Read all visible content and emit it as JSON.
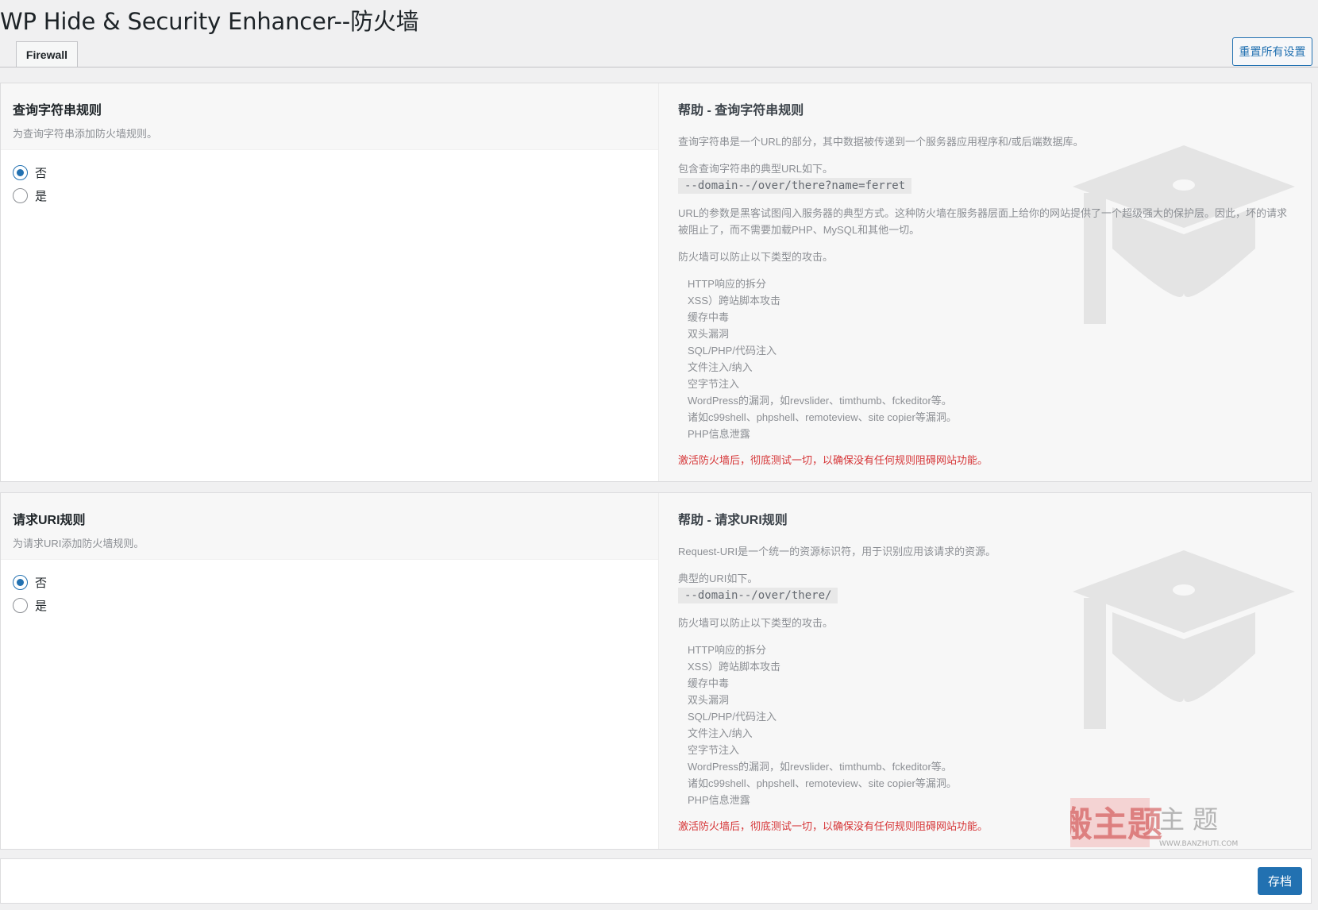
{
  "page": {
    "title": "WP Hide & Security Enhancer--防火墙"
  },
  "tabs": [
    {
      "label": "Firewall",
      "active": true
    }
  ],
  "header": {
    "reset_label": "重置所有设置"
  },
  "sections": [
    {
      "title": "查询字符串规则",
      "description": "为查询字符串添加防火墙规则。",
      "options": [
        {
          "label": "否",
          "checked": true
        },
        {
          "label": "是",
          "checked": false
        }
      ],
      "help": {
        "title": "帮助 - 查询字符串规则",
        "intro": "查询字符串是一个URL的部分，其中数据被传递到一个服务器应用程序和/或后端数据库。",
        "example_label": "包含查询字符串的典型URL如下。",
        "example_code": "--domain--/over/there?name=ferret",
        "extra": "URL的参数是黑客试图闯入服务器的典型方式。这种防火墙在服务器层面上给你的网站提供了一个超级强大的保护层。因此，坏的请求被阻止了，而不需要加载PHP、MySQL和其他一切。",
        "list_intro": "防火墙可以防止以下类型的攻击。",
        "attacks": [
          "HTTP响应的拆分",
          "XSS）跨站脚本攻击",
          "缓存中毒",
          "双头漏洞",
          "SQL/PHP/代码注入",
          "文件注入/纳入",
          "空字节注入",
          "WordPress的漏洞，如revslider、timthumb、fckeditor等。",
          "诸如c99shell、phpshell、remoteview、site copier等漏洞。",
          "PHP信息泄露"
        ],
        "warning": "激活防火墙后，彻底测试一切，以确保没有任何规则阻碍网站功能。"
      }
    },
    {
      "title": "请求URI规则",
      "description": "为请求URI添加防火墙规则。",
      "options": [
        {
          "label": "否",
          "checked": true
        },
        {
          "label": "是",
          "checked": false
        }
      ],
      "help": {
        "title": "帮助 - 请求URI规则",
        "intro": "Request-URI是一个统一的资源标识符，用于识别应用该请求的资源。",
        "example_label": "典型的URI如下。",
        "example_code": "--domain--/over/there/",
        "list_intro": "防火墙可以防止以下类型的攻击。",
        "attacks": [
          "HTTP响应的拆分",
          "XSS）跨站脚本攻击",
          "缓存中毒",
          "双头漏洞",
          "SQL/PHP/代码注入",
          "文件注入/纳入",
          "空字节注入",
          "WordPress的漏洞，如revslider、timthumb、fckeditor等。",
          "诸如c99shell、phpshell、remoteview、site copier等漏洞。",
          "PHP信息泄露"
        ],
        "warning": "激活防火墙后，彻底测试一切，以确保没有任何规则阻碍网站功能。"
      }
    }
  ],
  "footer": {
    "save_label": "存档"
  },
  "watermark": {
    "text": "搬主题",
    "url": "WWW.BANZHUTI.COM"
  },
  "colors": {
    "accent": "#2271b1",
    "warning": "#d63638",
    "background": "#f0f0f1"
  }
}
